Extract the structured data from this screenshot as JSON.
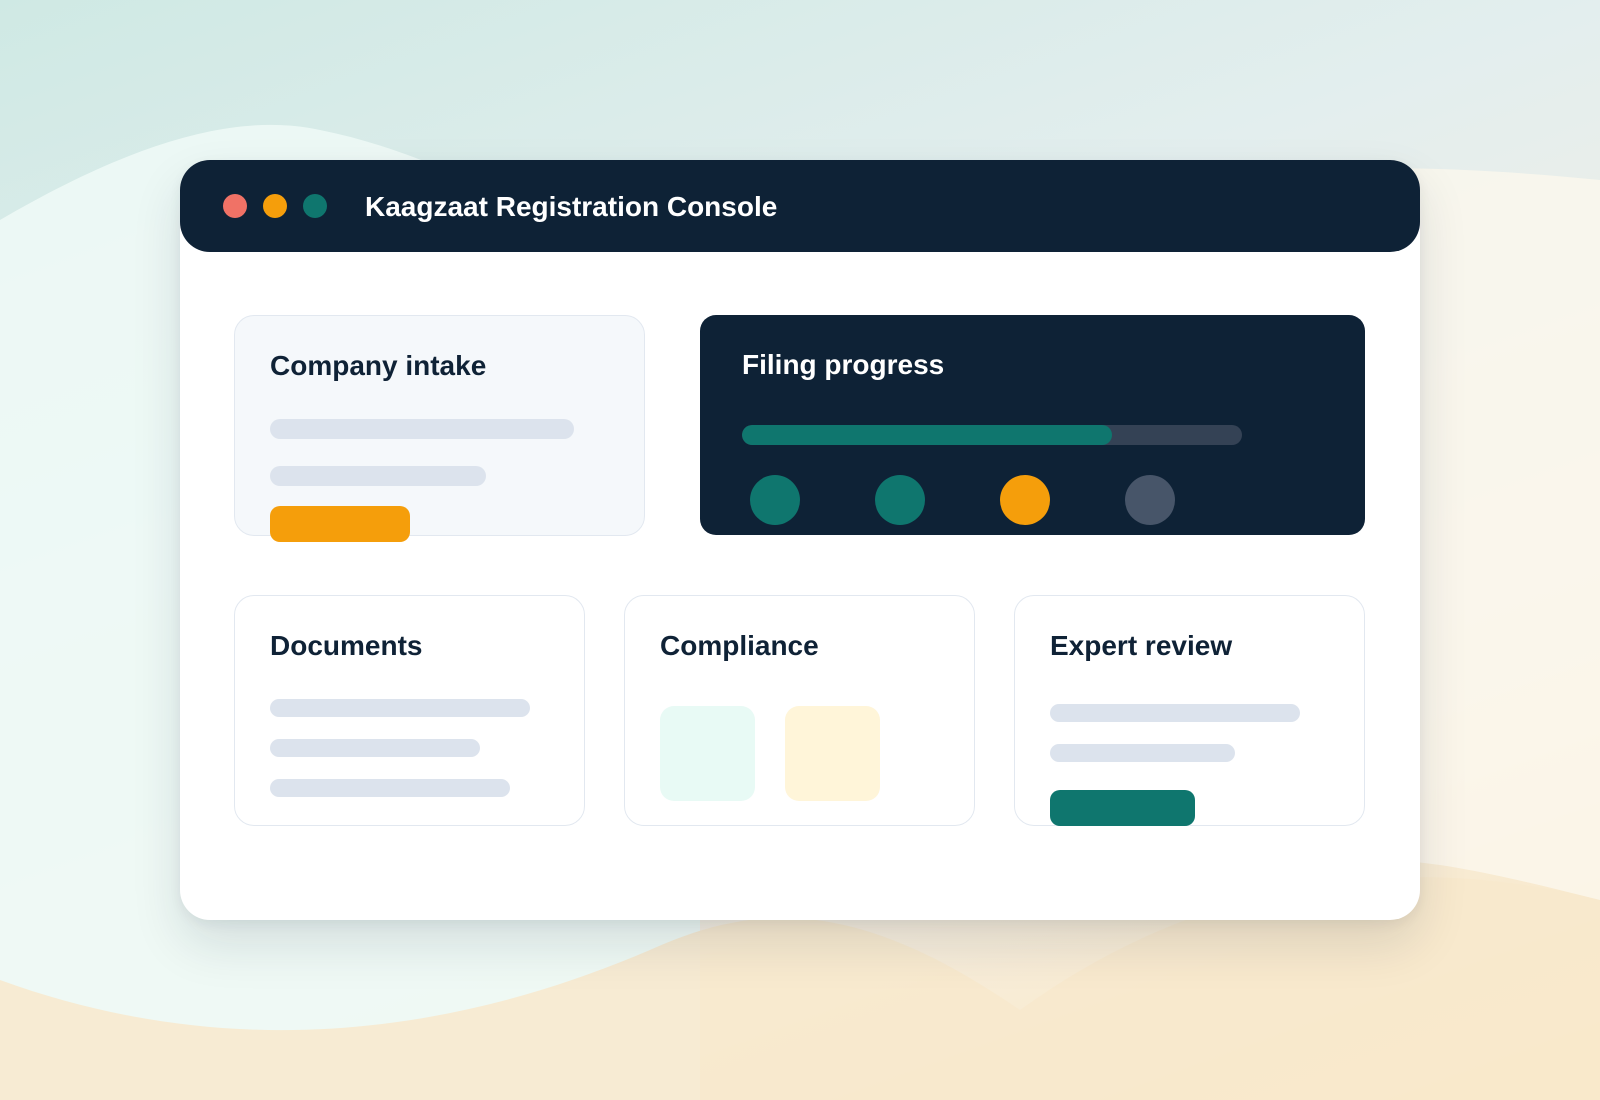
{
  "window": {
    "title": "Kaagzaat Registration Console"
  },
  "cards": {
    "company_intake": {
      "title": "Company intake"
    },
    "filing_progress": {
      "title": "Filing progress",
      "progress_fraction": 0.74,
      "steps": [
        {
          "state": "complete",
          "color": "#0f766e"
        },
        {
          "state": "complete",
          "color": "#0f766e"
        },
        {
          "state": "current",
          "color": "#f59e0b"
        },
        {
          "state": "pending",
          "color": "#475569"
        }
      ]
    },
    "documents": {
      "title": "Documents"
    },
    "compliance": {
      "title": "Compliance"
    },
    "expert_review": {
      "title": "Expert review"
    }
  },
  "colors": {
    "navy": "#0e2236",
    "teal": "#0f766e",
    "amber": "#f59e0b",
    "coral": "#f07266",
    "placeholder": "#dce3ed"
  }
}
